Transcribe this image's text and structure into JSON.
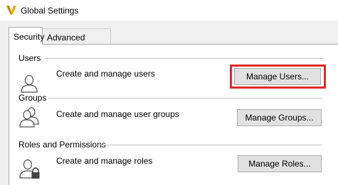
{
  "window": {
    "title": "Global Settings",
    "app_icon": "vault-logo-icon",
    "brand_color": "#f2a900"
  },
  "tabs": [
    {
      "label": "Security",
      "active": true
    },
    {
      "label": "Advanced Settings",
      "active": false
    }
  ],
  "sections": {
    "users": {
      "heading": "Users",
      "description": "Create and manage users",
      "button_label": "Manage Users...",
      "icon": "user-icon",
      "highlighted": true,
      "highlight_color": "#e02a2a"
    },
    "groups": {
      "heading": "Groups",
      "description": "Create and manage user groups",
      "button_label": "Manage Groups...",
      "icon": "user-group-icon"
    },
    "roles": {
      "heading": "Roles and Permissions",
      "description": "Create and manage roles",
      "button_label": "Manage Roles...",
      "icon": "user-lock-icon"
    }
  }
}
